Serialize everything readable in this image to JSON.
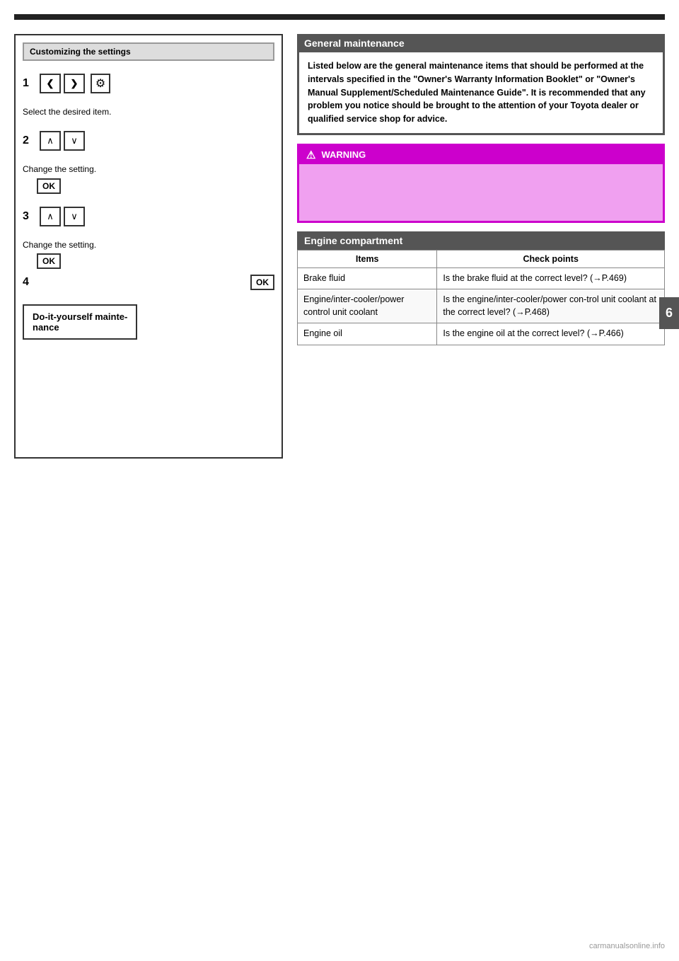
{
  "page": {
    "chapter_number": "6",
    "top_bar_visible": true
  },
  "left_column": {
    "header": "Customizing the settings",
    "steps": [
      {
        "number": "1",
        "text": "Select the desired item.",
        "has_lr_buttons": true,
        "has_gear": true,
        "lr_left": "‹",
        "lr_right": "›"
      },
      {
        "number": "2",
        "text": "Change the setting.",
        "has_ud_buttons": true,
        "up": "∧",
        "down": "∨"
      },
      {
        "number": "3",
        "text": "Change the setting.",
        "has_ud_buttons": true,
        "up": "∧",
        "down": "∨",
        "has_ok": true
      },
      {
        "number": "4",
        "text": "",
        "has_ok_right": true
      }
    ],
    "ok_label": "OK",
    "diy_box": {
      "line1": "Do-it-yourself mainte-",
      "line2": "nance"
    }
  },
  "right_column": {
    "general_maintenance": {
      "header": "General maintenance",
      "body": "Listed below are the general maintenance items that should be performed at the intervals specified in the \"Owner's Warranty Information Booklet\" or \"Owner's Manual Supplement/Scheduled Maintenance Guide\". It is recommended that any problem you notice should be brought to the attention of your Toyota dealer or qualified service shop for advice."
    },
    "warning": {
      "header": "WARNING",
      "content": ""
    },
    "engine_compartment": {
      "header": "Engine compartment",
      "table": {
        "columns": [
          "Items",
          "Check points"
        ],
        "rows": [
          {
            "item": "Brake fluid",
            "check": "Is the brake fluid at the correct level? (→P.469)"
          },
          {
            "item": "Engine/inter-cooler/power control unit coolant",
            "check": "Is the engine/inter-cooler/power con-trol unit coolant at the correct level? (→P.468)"
          },
          {
            "item": "Engine oil",
            "check": "Is the engine oil at the correct level? (→P.466)"
          }
        ]
      }
    }
  },
  "footer": {
    "watermark": "carmanualsonline.info"
  },
  "icons": {
    "gear": "⚙",
    "chevron_left": "❮",
    "chevron_right": "❯",
    "chevron_up": "∧",
    "chevron_down": "∨",
    "warning_triangle": "⚠"
  }
}
